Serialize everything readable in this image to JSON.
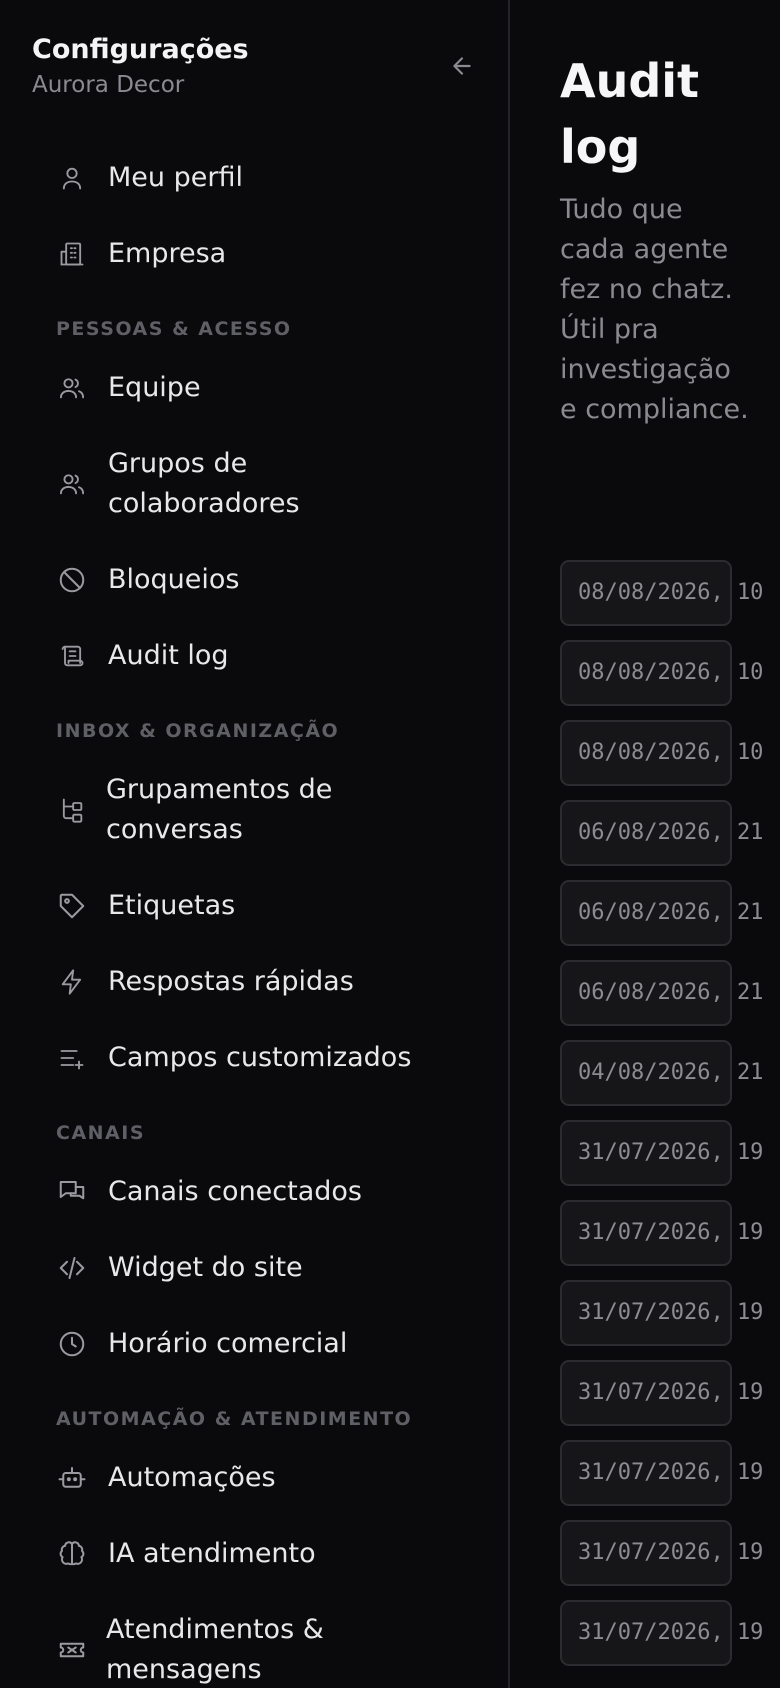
{
  "sidebar": {
    "title": "Configurações",
    "subtitle": "Aurora Decor",
    "items": [
      {
        "label": "Meu perfil"
      },
      {
        "label": "Empresa"
      },
      {
        "label": "Equipe"
      },
      {
        "label": "Grupos de colaboradores"
      },
      {
        "label": "Bloqueios"
      },
      {
        "label": "Audit log"
      },
      {
        "label": "Grupamentos de conversas"
      },
      {
        "label": "Etiquetas"
      },
      {
        "label": "Respostas rápidas"
      },
      {
        "label": "Campos customizados"
      },
      {
        "label": "Canais conectados"
      },
      {
        "label": "Widget do site"
      },
      {
        "label": "Horário comercial"
      },
      {
        "label": "Automações"
      },
      {
        "label": "IA atendimento"
      },
      {
        "label": "Atendimentos & mensagens"
      }
    ],
    "sections": [
      {
        "label": "PESSOAS & ACESSO"
      },
      {
        "label": "INBOX & ORGANIZAÇÃO"
      },
      {
        "label": "CANAIS"
      },
      {
        "label": "AUTOMAÇÃO & ATENDIMENTO"
      }
    ]
  },
  "main": {
    "title": "Audit log",
    "description": "Tudo que cada agente fez no chatz. Útil pra investigação e compliance.",
    "log": [
      {
        "date": "08/08/2026, 10"
      },
      {
        "date": "08/08/2026, 10"
      },
      {
        "date": "08/08/2026, 10"
      },
      {
        "date": "06/08/2026, 21"
      },
      {
        "date": "06/08/2026, 21"
      },
      {
        "date": "06/08/2026, 21"
      },
      {
        "date": "04/08/2026, 21"
      },
      {
        "date": "31/07/2026, 19"
      },
      {
        "date": "31/07/2026, 19"
      },
      {
        "date": "31/07/2026, 19"
      },
      {
        "date": "31/07/2026, 19"
      },
      {
        "date": "31/07/2026, 19"
      },
      {
        "date": "31/07/2026, 19"
      },
      {
        "date": "31/07/2026, 19"
      }
    ]
  },
  "colors": {
    "background": "#0a0a0c",
    "text": "#e6e6e8",
    "muted": "#8a8a90",
    "section": "#5f5f66"
  }
}
